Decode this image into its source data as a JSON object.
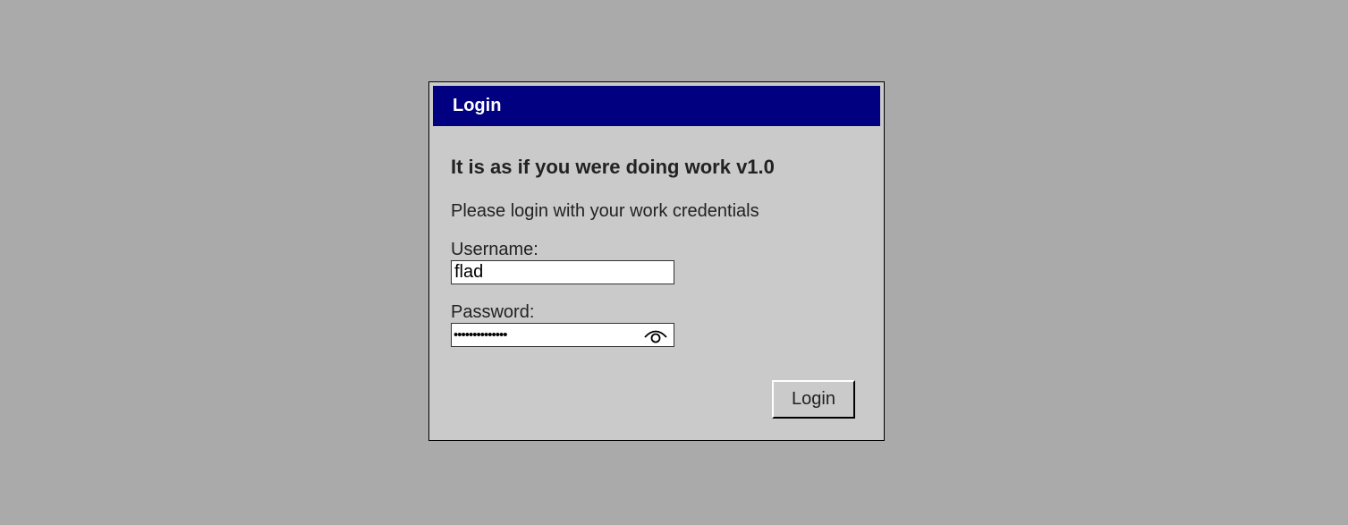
{
  "dialog": {
    "title": "Login",
    "heading": "It is as if you were doing work v1.0",
    "subtitle": "Please login with your work credentials",
    "username": {
      "label": "Username:",
      "value": "flad"
    },
    "password": {
      "label": "Password:",
      "masked_value": "••••••••••••••",
      "reveal_icon": "eye-icon"
    },
    "login_button": "Login"
  },
  "colors": {
    "background": "#aaaaaa",
    "dialog_background": "#cacaca",
    "titlebar": "#000080",
    "titlebar_text": "#ffffff"
  }
}
